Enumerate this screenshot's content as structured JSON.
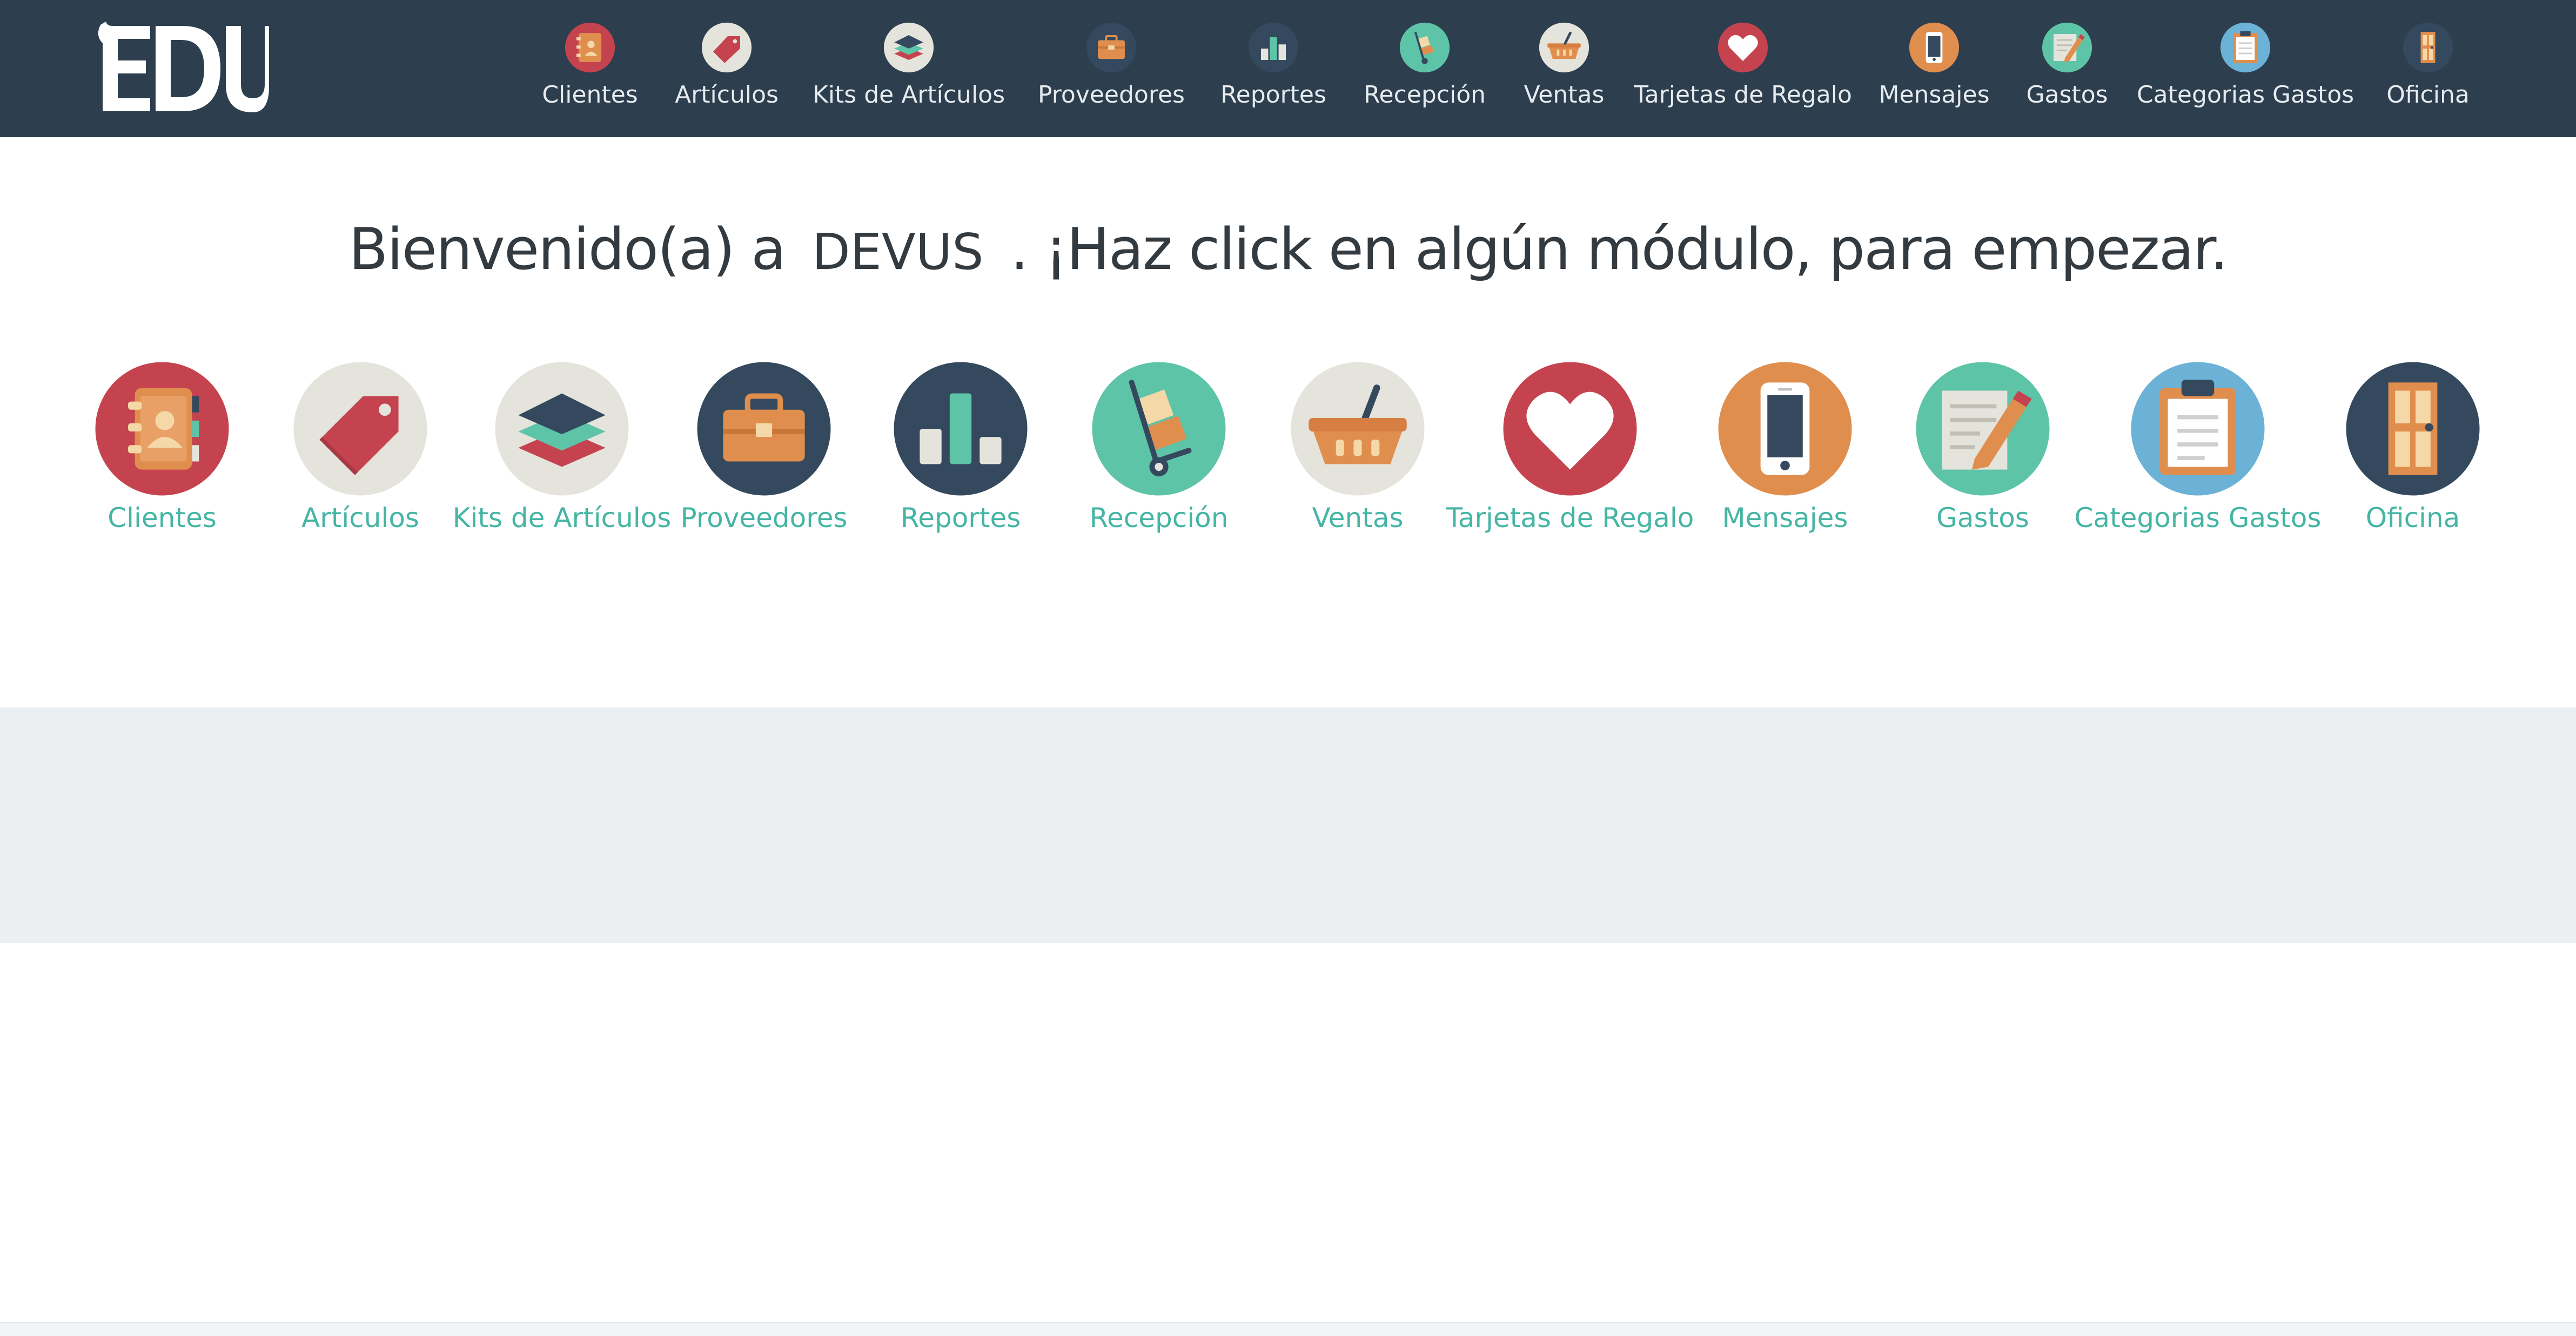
{
  "app": {
    "logo_text": "EDU"
  },
  "nav": {
    "items": [
      {
        "key": "clientes",
        "label": "Clientes",
        "icon": "address-book-icon",
        "color": "#c5434f"
      },
      {
        "key": "articulos",
        "label": "Artículos",
        "icon": "tag-icon",
        "color": "#e5e4dc"
      },
      {
        "key": "kits",
        "label": "Kits de Artículos",
        "icon": "layers-icon",
        "color": "#e5e4dc"
      },
      {
        "key": "proveedores",
        "label": "Proveedores",
        "icon": "briefcase-icon",
        "color": "#34495e"
      },
      {
        "key": "reportes",
        "label": "Reportes",
        "icon": "bar-chart-icon",
        "color": "#34495e"
      },
      {
        "key": "recepcion",
        "label": "Recepción",
        "icon": "hand-truck-icon",
        "color": "#5ec4a8"
      },
      {
        "key": "ventas",
        "label": "Ventas",
        "icon": "basket-icon",
        "color": "#e5e4dc"
      },
      {
        "key": "tarjetas",
        "label": "Tarjetas de Regalo",
        "icon": "heart-icon",
        "color": "#c5434f"
      },
      {
        "key": "mensajes",
        "label": "Mensajes",
        "icon": "phone-icon",
        "color": "#e08e4e"
      },
      {
        "key": "gastos",
        "label": "Gastos",
        "icon": "notepad-pencil-icon",
        "color": "#5ec4a8"
      },
      {
        "key": "categorias",
        "label": "Categorias Gastos",
        "icon": "clipboard-icon",
        "color": "#6bb2d6"
      },
      {
        "key": "oficina",
        "label": "Oficina",
        "icon": "door-icon",
        "color": "#34495e"
      }
    ]
  },
  "welcome": {
    "prefix": "Bienvenido(a) a",
    "company": "DEVUS",
    "suffix": ". ¡Haz click en algún módulo, para empezar."
  },
  "modules": {
    "items": [
      {
        "key": "clientes",
        "label": "Clientes"
      },
      {
        "key": "articulos",
        "label": "Artículos"
      },
      {
        "key": "kits",
        "label": "Kits de Artículos"
      },
      {
        "key": "proveedores",
        "label": "Proveedores"
      },
      {
        "key": "reportes",
        "label": "Reportes"
      },
      {
        "key": "recepcion",
        "label": "Recepción"
      },
      {
        "key": "ventas",
        "label": "Ventas"
      },
      {
        "key": "tarjetas",
        "label": "Tarjetas de Regalo"
      },
      {
        "key": "mensajes",
        "label": "Mensajes"
      },
      {
        "key": "gastos",
        "label": "Gastos"
      },
      {
        "key": "categorias",
        "label": "Categorias Gastos"
      },
      {
        "key": "oficina",
        "label": "Oficina"
      }
    ]
  },
  "colors": {
    "navbar": "#2d3e4e",
    "module_label": "#45b5a4",
    "grey_band": "#eceff1"
  }
}
